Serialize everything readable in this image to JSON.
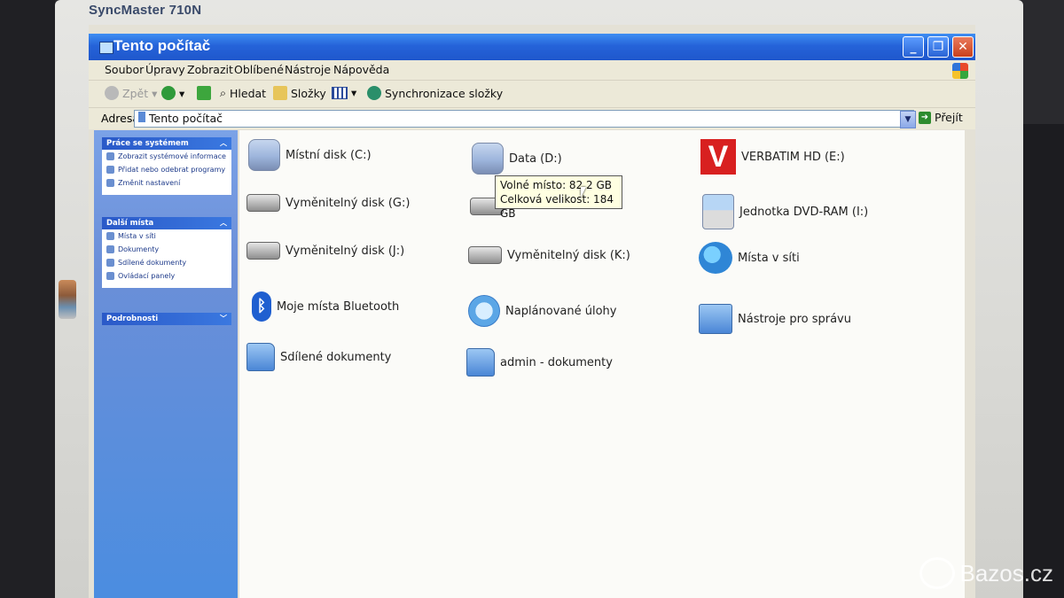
{
  "monitor": {
    "brand": "SyncMaster 710N"
  },
  "window": {
    "title": "Tento počítač",
    "controls": [
      "_",
      "❐",
      "✕"
    ]
  },
  "menu": [
    "Soubor",
    "Úpravy",
    "Zobrazit",
    "Oblíbené",
    "Nástroje",
    "Nápověda"
  ],
  "toolbar": {
    "back": "Zpět",
    "search": "Hledat",
    "folders": "Složky",
    "sync": "Synchronizace složky"
  },
  "address": {
    "label": "Adresa",
    "value": "Tento počítač",
    "go": "Přejít"
  },
  "leftpane": {
    "system_tasks": {
      "title": "Práce se systémem",
      "items": [
        "Zobrazit systémové informace",
        "Přidat nebo odebrat programy",
        "Změnit nastavení"
      ]
    },
    "other_places": {
      "title": "Další místa",
      "items": [
        "Místa v síti",
        "Dokumenty",
        "Sdílené dokumenty",
        "Ovládací panely"
      ]
    },
    "details": {
      "title": "Podrobnosti"
    }
  },
  "items": {
    "c": "Místní disk (C:)",
    "d": "Data (D:)",
    "e": "VERBATIM HD (E:)",
    "g": "Vyměnitelný disk (G:)",
    "i": "Jednotka DVD-RAM (I:)",
    "j": "Vyměnitelný disk (J:)",
    "k": "Vyměnitelný disk (K:)",
    "net": "Místa v síti",
    "bt": "Moje místa Bluetooth",
    "tasks": "Naplánované úlohy",
    "tools": "Nástroje pro správu",
    "shared": "Sdílené dokumenty",
    "admin": "admin - dokumenty"
  },
  "tooltip": {
    "line1": "Volné místo: 82,2 GB",
    "line2": "Celková velikost: 184 GB"
  },
  "watermark": "Bazos.cz"
}
